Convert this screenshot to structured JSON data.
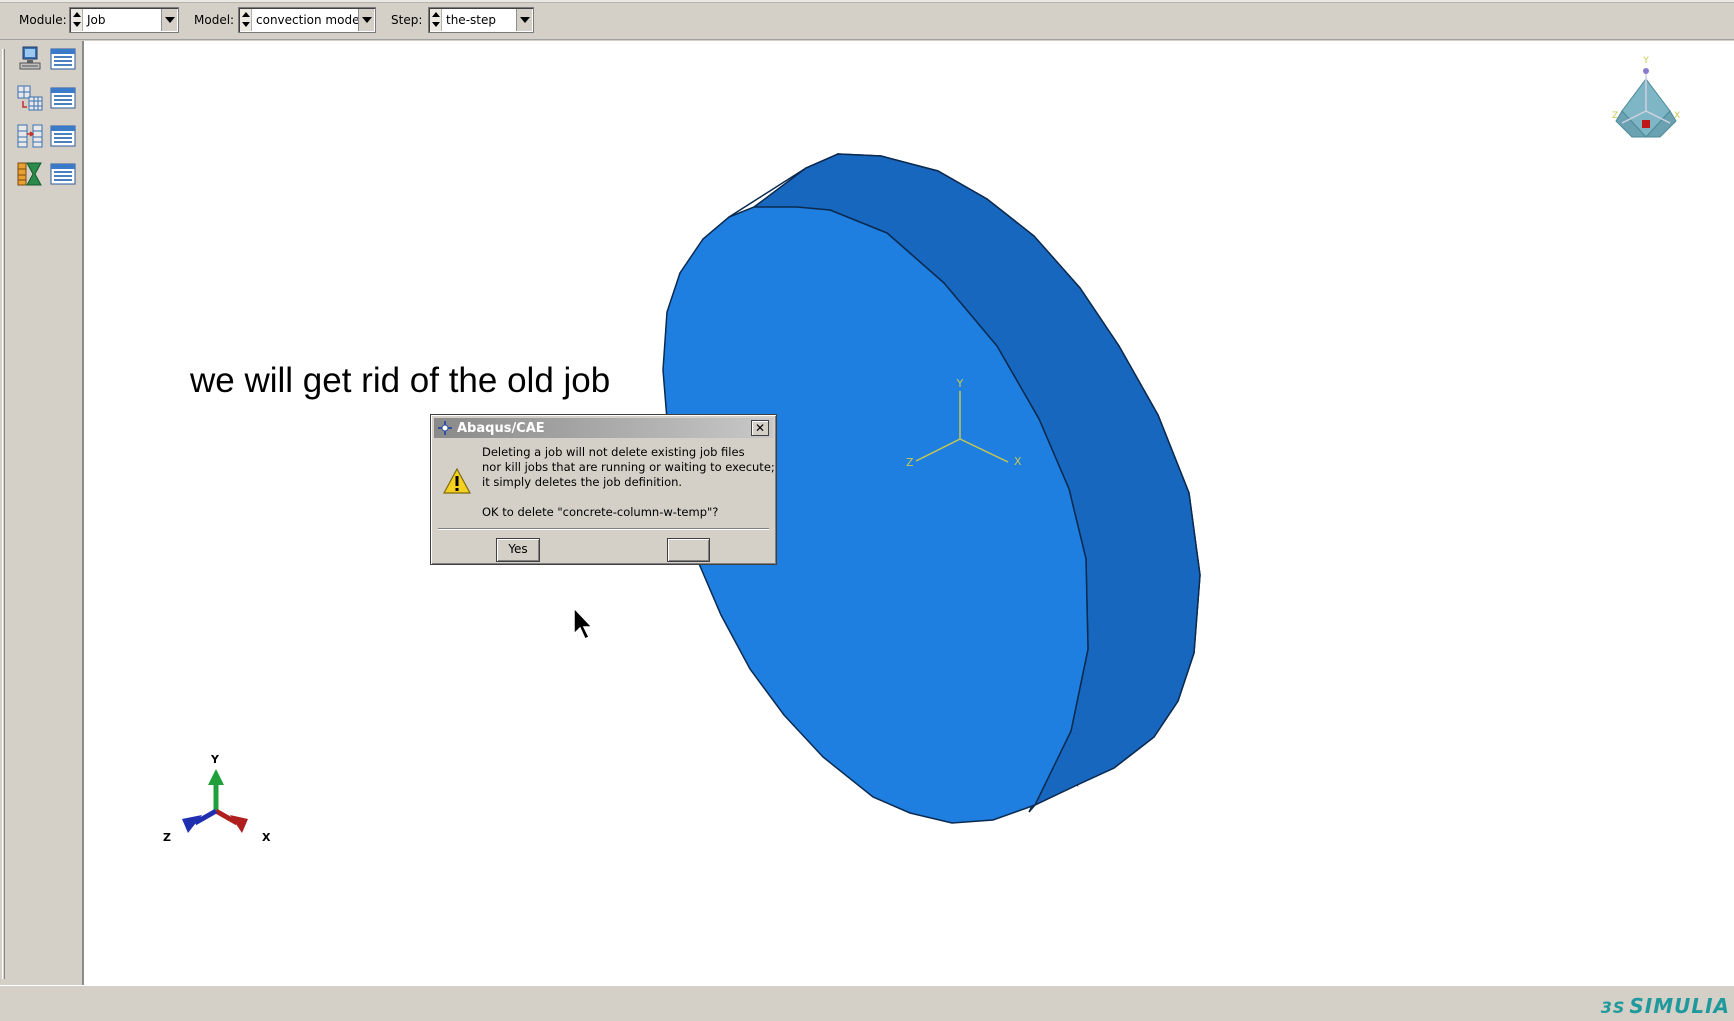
{
  "context_bar": {
    "module_label": "Module:",
    "module_value": "Job",
    "model_label": "Model:",
    "model_value": "convection model",
    "step_label": "Step:",
    "step_value": "the-step"
  },
  "toolbox": {
    "items": [
      {
        "icon": "job-create-icon"
      },
      {
        "icon": "job-manager-icon"
      },
      {
        "icon": "adaptivity-create-icon"
      },
      {
        "icon": "adaptivity-manager-icon"
      },
      {
        "icon": "co-execution-create-icon"
      },
      {
        "icon": "co-execution-manager-icon"
      },
      {
        "icon": "optimization-create-icon"
      },
      {
        "icon": "optimization-manager-icon"
      }
    ]
  },
  "viewport": {
    "caption": "we will get rid of the old job",
    "model_color": "#1f7fe0",
    "model_side_color": "#125aa8",
    "local_csys": {
      "x": "X",
      "y": "Y",
      "z": "Z"
    },
    "global_triad": {
      "x": "X",
      "y": "Y",
      "z": "Z"
    },
    "view_cube": {
      "x": "X",
      "y": "Y",
      "z": "Z"
    }
  },
  "dialog": {
    "title": "Abaqus/CAE",
    "close_label": "✕",
    "message_lines": [
      "Deleting a job will not delete existing job files",
      "nor kill jobs that are running or waiting to execute;",
      "it simply deletes the job definition."
    ],
    "question": "OK to delete \"concrete-column-w-temp\"?",
    "yes_label": "Yes",
    "no_label": ""
  },
  "statusbar": {
    "brand": "SIMULIA",
    "brand_mark": "3S"
  }
}
